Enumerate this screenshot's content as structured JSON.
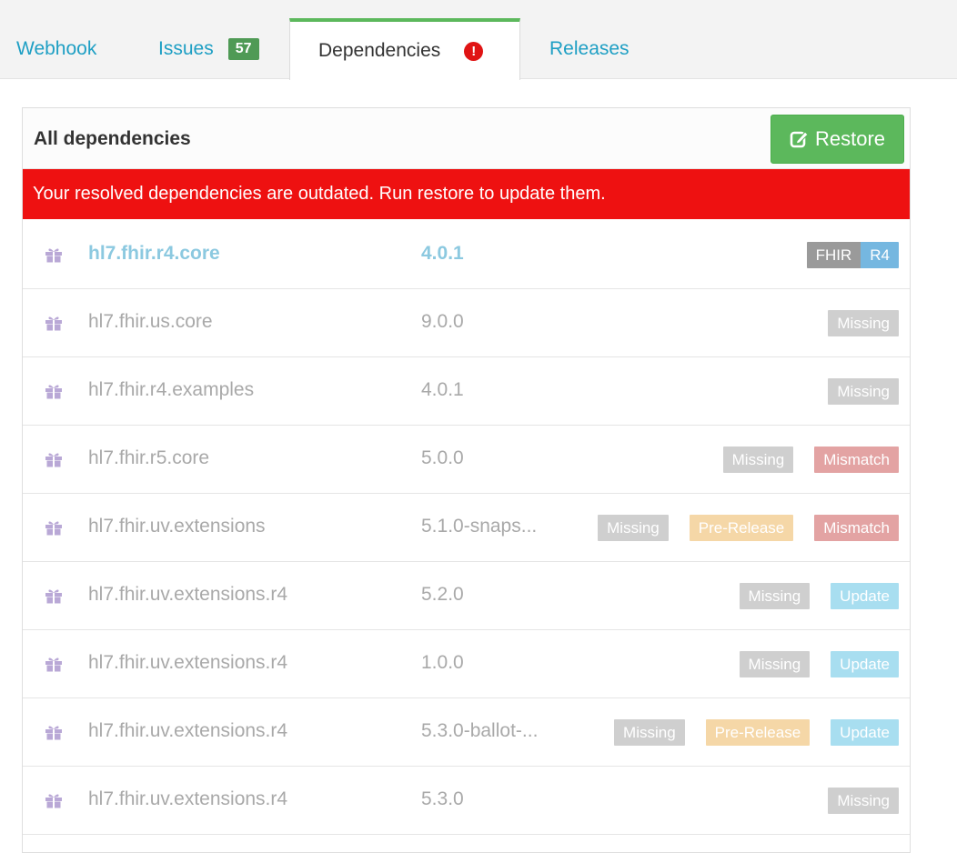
{
  "tabs": [
    {
      "label": "Webhook"
    },
    {
      "label": "Issues",
      "count": "57"
    },
    {
      "label": "Dependencies",
      "alert": "!"
    },
    {
      "label": "Releases"
    }
  ],
  "panel": {
    "title": "All dependencies",
    "restore_label": "Restore",
    "warning": "Your resolved dependencies are outdated. Run restore to update them."
  },
  "dependencies": [
    {
      "name": "hl7.fhir.r4.core",
      "version": "4.0.1",
      "badges": [
        "FHIR",
        "R4"
      ]
    },
    {
      "name": "hl7.fhir.us.core",
      "version": "9.0.0",
      "badges": [
        "Missing"
      ]
    },
    {
      "name": "hl7.fhir.r4.examples",
      "version": "4.0.1",
      "badges": [
        "Missing"
      ]
    },
    {
      "name": "hl7.fhir.r5.core",
      "version": "5.0.0",
      "badges": [
        "Missing",
        "Mismatch"
      ]
    },
    {
      "name": "hl7.fhir.uv.extensions",
      "version": "5.1.0-snaps...",
      "badges": [
        "Missing",
        "Pre-Release",
        "Mismatch"
      ]
    },
    {
      "name": "hl7.fhir.uv.extensions.r4",
      "version": "5.2.0",
      "badges": [
        "Missing",
        "Update"
      ]
    },
    {
      "name": "hl7.fhir.uv.extensions.r4",
      "version": "1.0.0",
      "badges": [
        "Missing",
        "Update"
      ]
    },
    {
      "name": "hl7.fhir.uv.extensions.r4",
      "version": "5.3.0-ballot-...",
      "badges": [
        "Missing",
        "Pre-Release",
        "Update"
      ]
    },
    {
      "name": "hl7.fhir.uv.extensions.r4",
      "version": "5.3.0",
      "badges": [
        "Missing"
      ]
    }
  ],
  "colors": {
    "active_tab_accent": "#5cb85c",
    "link": "#1e9fc4",
    "warning_bg": "#ee1111",
    "restore_bg": "#5cb85c",
    "missing": "#cfcfcf",
    "mismatch": "#e3a3a3",
    "prerelease": "#f5d7a7",
    "update": "#a8def0"
  },
  "icons": {
    "dependency": "gift-icon",
    "restore": "edit-icon",
    "alert": "exclamation-circle-icon"
  }
}
